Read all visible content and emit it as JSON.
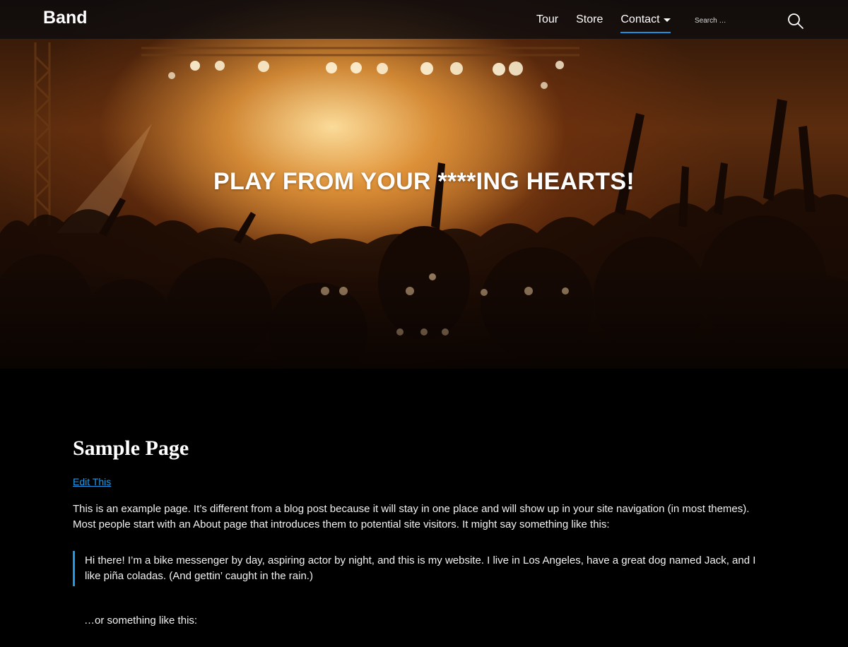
{
  "header": {
    "site_title": "Band",
    "nav": [
      {
        "label": "Tour"
      },
      {
        "label": "Store"
      },
      {
        "label": "Contact",
        "has_dropdown": true,
        "active": true
      }
    ],
    "search": {
      "placeholder": "Search …",
      "icon": "search-icon"
    }
  },
  "hero": {
    "title": "PLAY FROM YOUR ****ING HEARTS!"
  },
  "content": {
    "page_title": "Sample Page",
    "edit_link": "Edit This",
    "intro": "This is an example page. It’s different from a blog post because it will stay in one place and will show up in your site navigation (in most themes). Most people start with an About page that introduces them to potential site visitors. It might say something like this:",
    "quote": "Hi there! I’m a bike messenger by day, aspiring actor by night, and this is my website. I live in Los Angeles, have a great dog named Jack, and I like piña coladas. (And gettin’ caught in the rain.)",
    "after_quote": "…or something like this:"
  },
  "colors": {
    "accent": "#1e9be8",
    "background": "#000000",
    "header_bg": "#0c0c0e"
  }
}
